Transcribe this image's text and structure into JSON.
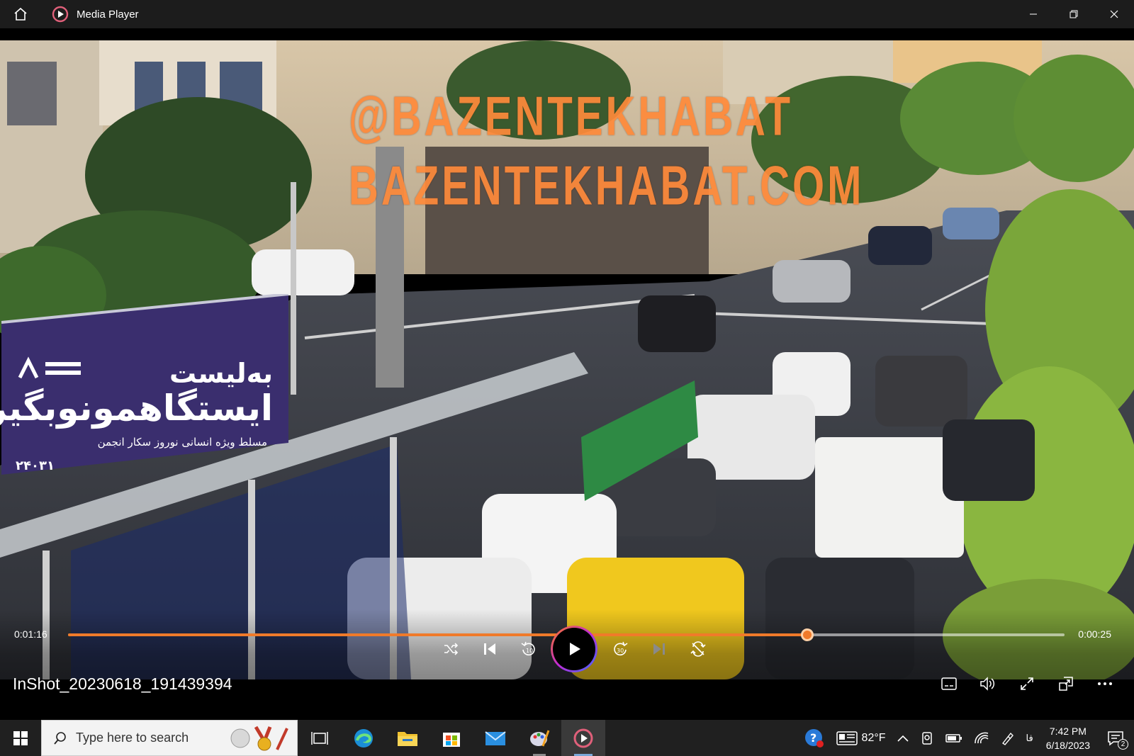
{
  "window": {
    "title": "Media Player"
  },
  "watermark": {
    "line1": "@BAZENTEKHABAT",
    "line2": "BAZENTEKHABAT.COM"
  },
  "billboard": {
    "line1": "به‌لیست",
    "line2": "ایستگاهمونوبگیر!",
    "line3": "مسلط ویژه انسانی نوروز سکار انجمن",
    "line4": "۲۴۰۳۱"
  },
  "player": {
    "elapsed": "0:01:16",
    "remaining": "0:00:25",
    "progress": 0.742,
    "file_name": "InShot_20230618_191439394"
  },
  "taskbar": {
    "search_placeholder": "Type here to search",
    "temperature": "82°F",
    "time": "7:42 PM",
    "date": "6/18/2023",
    "language": "فا",
    "notification_count": "2"
  },
  "colors": {
    "accent": "#f07a2a",
    "watermark": "#ff8a3a",
    "taskbar": "#202020",
    "titlebar": "#1c1c1c"
  }
}
